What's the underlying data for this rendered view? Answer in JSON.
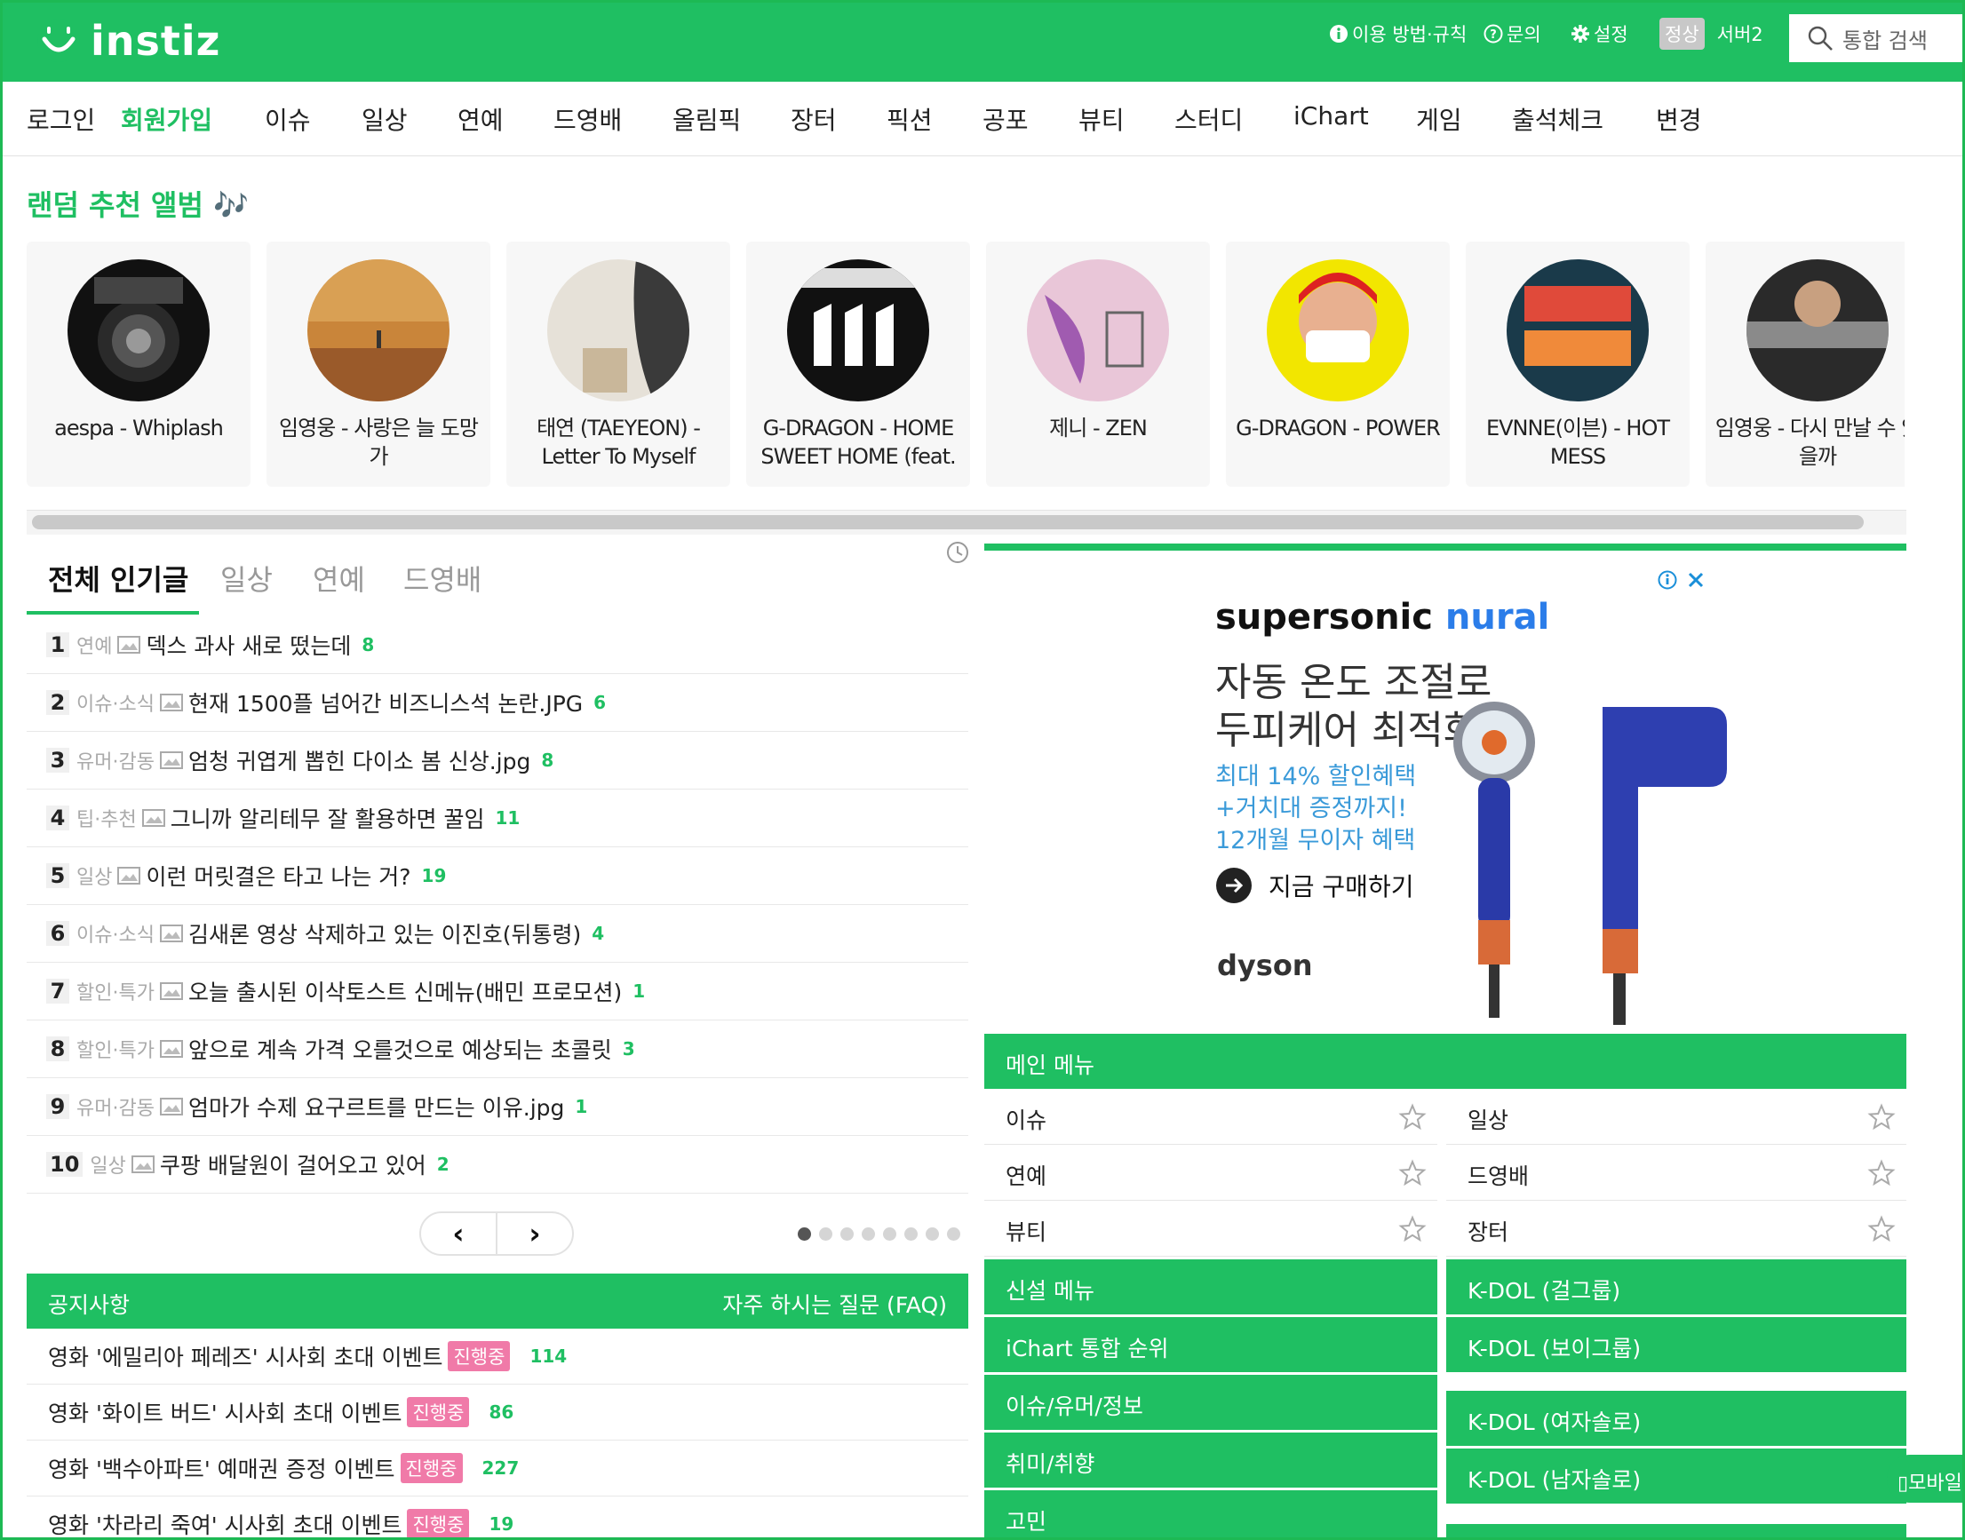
{
  "header": {
    "logo": "instiz",
    "util": [
      "이용 방법·규칙",
      "문의",
      "설정"
    ],
    "status_badge": "정상",
    "server": "서버2",
    "search_placeholder": "통합 검색"
  },
  "nav": [
    "로그인",
    "회원가입",
    "이슈",
    "일상",
    "연예",
    "드영배",
    "올림픽",
    "장터",
    "픽션",
    "공포",
    "뷰티",
    "스터디",
    "iChart",
    "게임",
    "출석체크",
    "변경"
  ],
  "albums_title": "랜덤 추천 앨범 🎶",
  "albums": [
    {
      "title": "aespa - Whiplash"
    },
    {
      "title": "임영웅 - 사랑은 늘 도망가"
    },
    {
      "title": "태연 (TAEYEON) - Letter To Myself"
    },
    {
      "title": "G-DRAGON - HOME SWEET HOME (feat. ..."
    },
    {
      "title": "제니 - ZEN"
    },
    {
      "title": "G-DRAGON - POWER"
    },
    {
      "title": "EVNNE(이븐) - HOT MESS"
    },
    {
      "title": "임영웅 - 다시 만날 수 있을까"
    }
  ],
  "popular": {
    "tabs": [
      "전체 인기글",
      "일상",
      "연예",
      "드영배"
    ],
    "items": [
      {
        "num": "1",
        "cat": "연예",
        "title": "덱스 과사 새로 떴는데",
        "count": "8"
      },
      {
        "num": "2",
        "cat": "이슈·소식",
        "title": "현재 1500플 넘어간 비즈니스석 논란.JPG",
        "count": "6"
      },
      {
        "num": "3",
        "cat": "유머·감동",
        "title": "엄청 귀엽게 뽑힌 다이소 봄 신상.jpg",
        "count": "8"
      },
      {
        "num": "4",
        "cat": "팁·추천",
        "title": "그니까 알리테무 잘 활용하면 꿀임",
        "count": "11"
      },
      {
        "num": "5",
        "cat": "일상",
        "title": "이런 머릿결은 타고 나는 거?",
        "count": "19"
      },
      {
        "num": "6",
        "cat": "이슈·소식",
        "title": "김새론 영상 삭제하고 있는 이진호(뒤통령)",
        "count": "4"
      },
      {
        "num": "7",
        "cat": "할인·특가",
        "title": "오늘 출시된 이삭토스트 신메뉴(배민 프로모션)",
        "count": "1"
      },
      {
        "num": "8",
        "cat": "할인·특가",
        "title": "앞으로 계속 가격 오를것으로 예상되는 초콜릿",
        "count": "3"
      },
      {
        "num": "9",
        "cat": "유머·감동",
        "title": "엄마가 수제 요구르트를 만드는 이유.jpg",
        "count": "1"
      },
      {
        "num": "10",
        "cat": "일상",
        "title": "쿠팡 배달원이 걸어오고 있어",
        "count": "2"
      }
    ],
    "pager_prev": "‹",
    "pager_next": "›"
  },
  "notice": {
    "title": "공지사항",
    "faq": "자주 하시는 질문 (FAQ)",
    "badge": "진행중",
    "items": [
      {
        "title": "영화 '에밀리아 페레즈' 시사회 초대 이벤트",
        "count": "114"
      },
      {
        "title": "영화 '화이트 버드' 시사회 초대 이벤트",
        "count": "86"
      },
      {
        "title": "영화 '백수아파트' 예매권 증정 이벤트",
        "count": "227"
      },
      {
        "title": "영화 '차라리 죽여' 시사회 초대 이벤트",
        "count": "19"
      }
    ]
  },
  "ad": {
    "brand_a": "supersonic ",
    "brand_b": "nural",
    "headline1": "자동 온도 조절로",
    "headline2": "두피케어 최적화",
    "sub1": "최대 14% 할인혜택",
    "sub2": "+거치대 증정까지!",
    "sub3": "12개월 무이자 혜택",
    "cta": "지금 구매하기",
    "logo": "dyson"
  },
  "menu": {
    "title": "메인 메뉴",
    "items": [
      "이슈",
      "일상",
      "연예",
      "드영배",
      "뷰티",
      "장터"
    ],
    "groups_left": [
      "신설 메뉴",
      "iChart 통합 순위",
      "이슈/유머/정보",
      "취미/취향",
      "고민"
    ],
    "groups_right": [
      "K-DOL (걸그룹)",
      "K-DOL (보이그룹)",
      "K-DOL (여자솔로)",
      "K-DOL (남자솔로)"
    ],
    "mobile": "모바일"
  },
  "colors": {
    "brand": "#1fbf62",
    "badge": "#f07aa8"
  }
}
